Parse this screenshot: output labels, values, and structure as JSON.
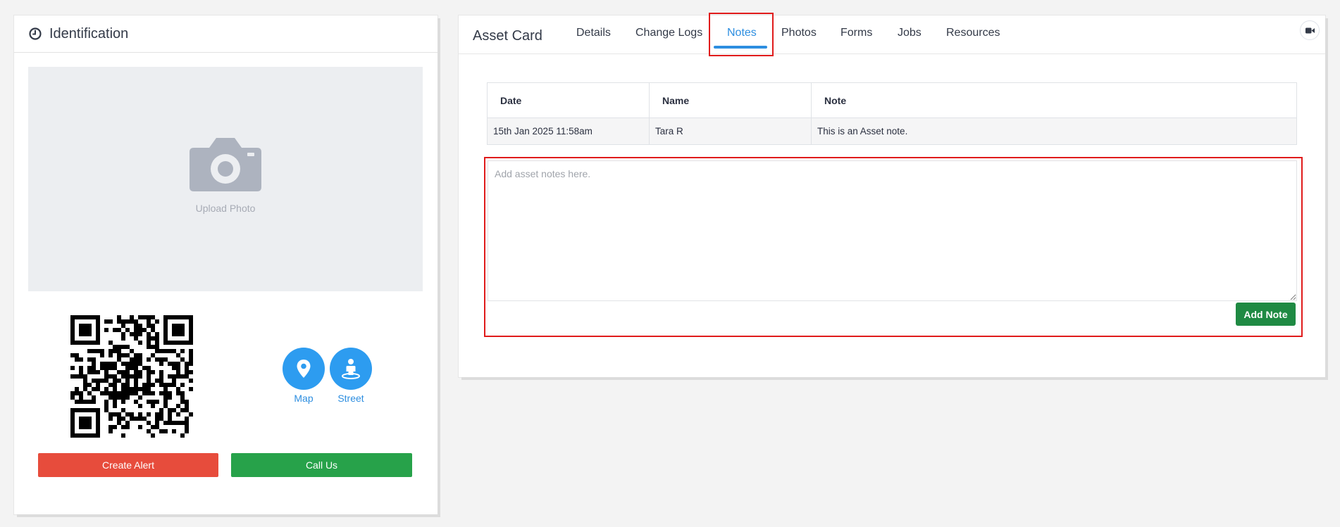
{
  "identification": {
    "title": "Identification",
    "upload_label": "Upload Photo",
    "map_label": "Map",
    "street_label": "Street",
    "create_alert_label": "Create Alert",
    "call_us_label": "Call Us"
  },
  "asset_card": {
    "title": "Asset Card",
    "tabs": [
      {
        "label": "Details"
      },
      {
        "label": "Change Logs"
      },
      {
        "label": "Notes",
        "active": true
      },
      {
        "label": "Photos"
      },
      {
        "label": "Forms"
      },
      {
        "label": "Jobs"
      },
      {
        "label": "Resources"
      }
    ]
  },
  "notes": {
    "columns": [
      "Date",
      "Name",
      "Note"
    ],
    "rows": [
      {
        "date": "15th Jan 2025 11:58am",
        "name": "Tara R",
        "note": "This is an Asset note."
      }
    ],
    "placeholder": "Add asset notes here.",
    "add_button": "Add Note"
  },
  "colors": {
    "accent": "#2d8ee0",
    "alert": "#e74c3c",
    "call": "#27a24a",
    "add_note": "#1f8a43",
    "highlight": "#e01b1b"
  },
  "icons": [
    "clock-icon",
    "camera-icon",
    "map-pin-icon",
    "street-view-icon",
    "video-camera-icon",
    "qr-code"
  ]
}
